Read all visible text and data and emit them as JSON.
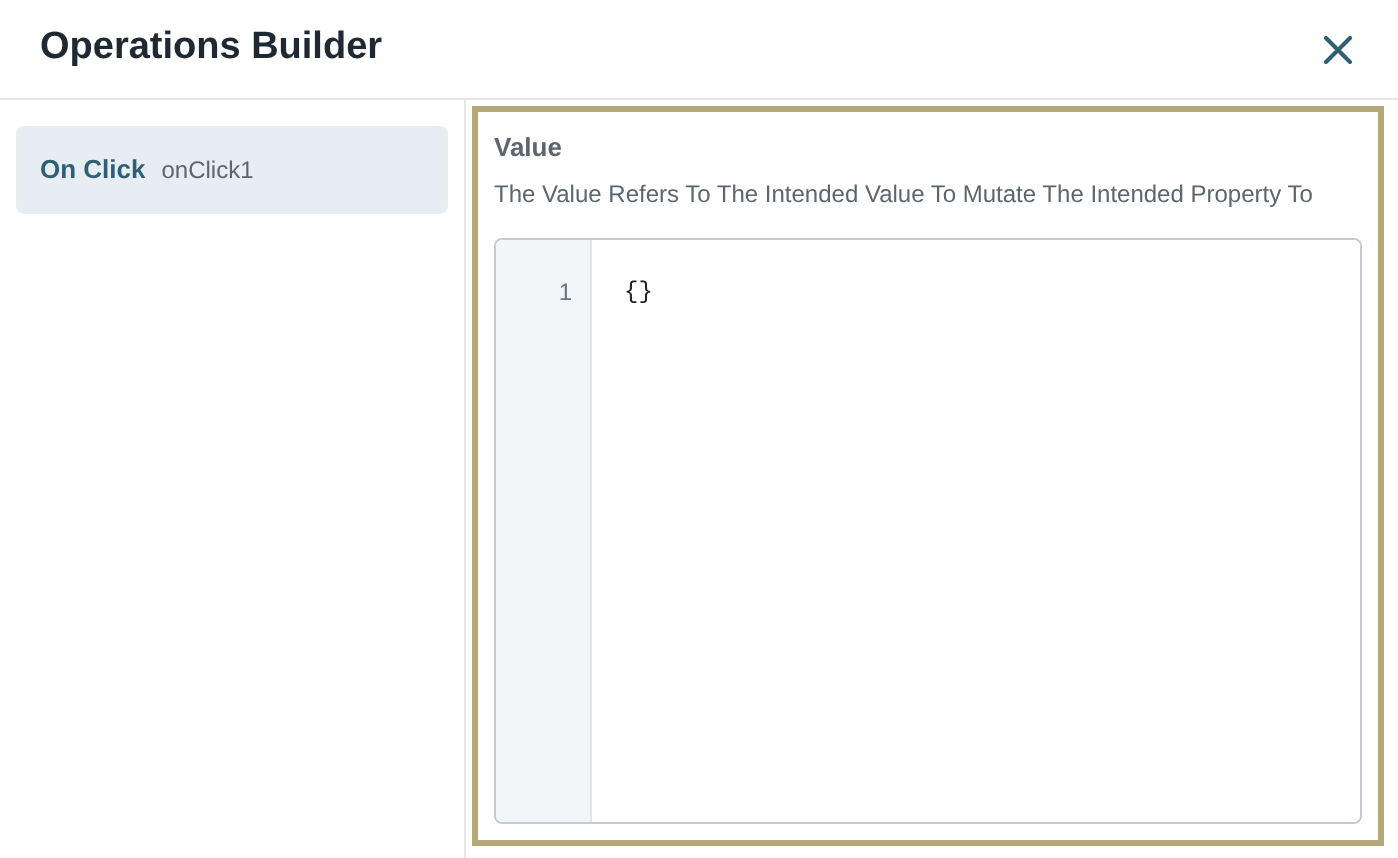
{
  "title": "Operations Builder",
  "operations": [
    {
      "label": "On Click",
      "name": "onClick1",
      "selected": true
    }
  ],
  "field": {
    "label": "Value",
    "description": "The Value Refers To The Intended Value To Mutate The Intended Property To",
    "lines": [
      {
        "number": "1",
        "code": "{}"
      }
    ]
  }
}
